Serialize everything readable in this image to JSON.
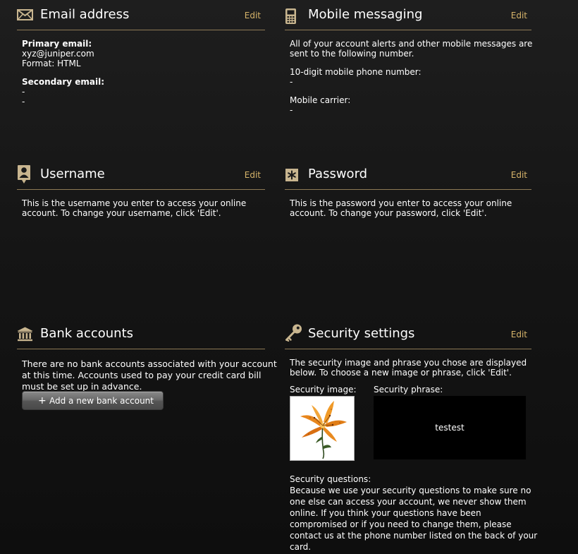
{
  "email": {
    "title": "Email address",
    "edit": "Edit",
    "primary_label": "Primary email:",
    "primary_value": "xyz@juniper.com",
    "format": "Format: HTML",
    "secondary_label": "Secondary email:",
    "secondary_value_1": "-",
    "secondary_value_2": "-"
  },
  "mobile": {
    "title": "Mobile messaging",
    "edit": "Edit",
    "intro_1": "All of your account alerts and other mobile messages are",
    "intro_2": "sent to the following number.",
    "phone_label": "10-digit mobile phone number:",
    "phone_value": "-",
    "carrier_label": "Mobile carrier:",
    "carrier_value": "-"
  },
  "username": {
    "title": "Username",
    "edit": "Edit",
    "desc_1": "This is the username you enter to access your online",
    "desc_2": "account. To change your username, click 'Edit'."
  },
  "password": {
    "title": "Password",
    "edit": "Edit",
    "desc_1": "This is the password you enter to access your online",
    "desc_2": "account. To change your password, click 'Edit'."
  },
  "bank": {
    "title": "Bank accounts",
    "desc_1": "There are no bank accounts associated with your account",
    "desc_2": "at this time. Accounts used to pay your credit card bill",
    "desc_3": "must be set up in advance.",
    "add_button": "Add a new bank account"
  },
  "security": {
    "title": "Security settings",
    "edit": "Edit",
    "desc_1": "The security image and phrase you chose are displayed",
    "desc_2": "below. To choose a new image or phrase, click 'Edit'.",
    "image_label": "Security image:",
    "phrase_label": "Security phrase:",
    "phrase_value": "testest",
    "questions_label": "Security questions:",
    "questions_1": "Because we use your security questions to make sure no",
    "questions_2": "one else can access your account, we never show them",
    "questions_3": "online. If you think your questions have been",
    "questions_4": "compromised or if you need to change them, please",
    "questions_5": "contact us at the phone number listed on the back of your",
    "questions_6": "card."
  },
  "colors": {
    "accent": "#d7b46a",
    "divider": "#8e7a55",
    "icon": "#c8b58f"
  },
  "icons": {
    "email": "envelope-icon",
    "mobile": "phone-icon",
    "username": "user-badge-icon",
    "password": "asterisk-icon",
    "bank": "bank-icon",
    "security": "key-icon"
  }
}
